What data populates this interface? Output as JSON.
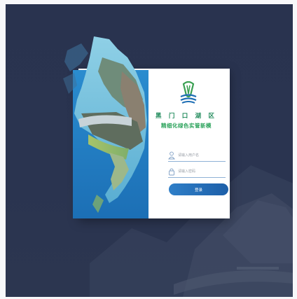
{
  "login": {
    "title_line1": "黑 门 口 湖 区",
    "title_line2": "精细化绿色实管新模",
    "username_placeholder": "请输入用户名",
    "password_placeholder": "请输入密码",
    "login_button_label": "登录",
    "username_value": "",
    "password_value": ""
  },
  "colors": {
    "background": "#2a3450",
    "card": "#ffffff",
    "title_green": "#1f8a5a",
    "button_blue": "#2668b6",
    "field_line": "#8fb2d6"
  },
  "icons": {
    "logo": "water-logo-icon",
    "username": "user-icon",
    "password": "lock-icon"
  }
}
